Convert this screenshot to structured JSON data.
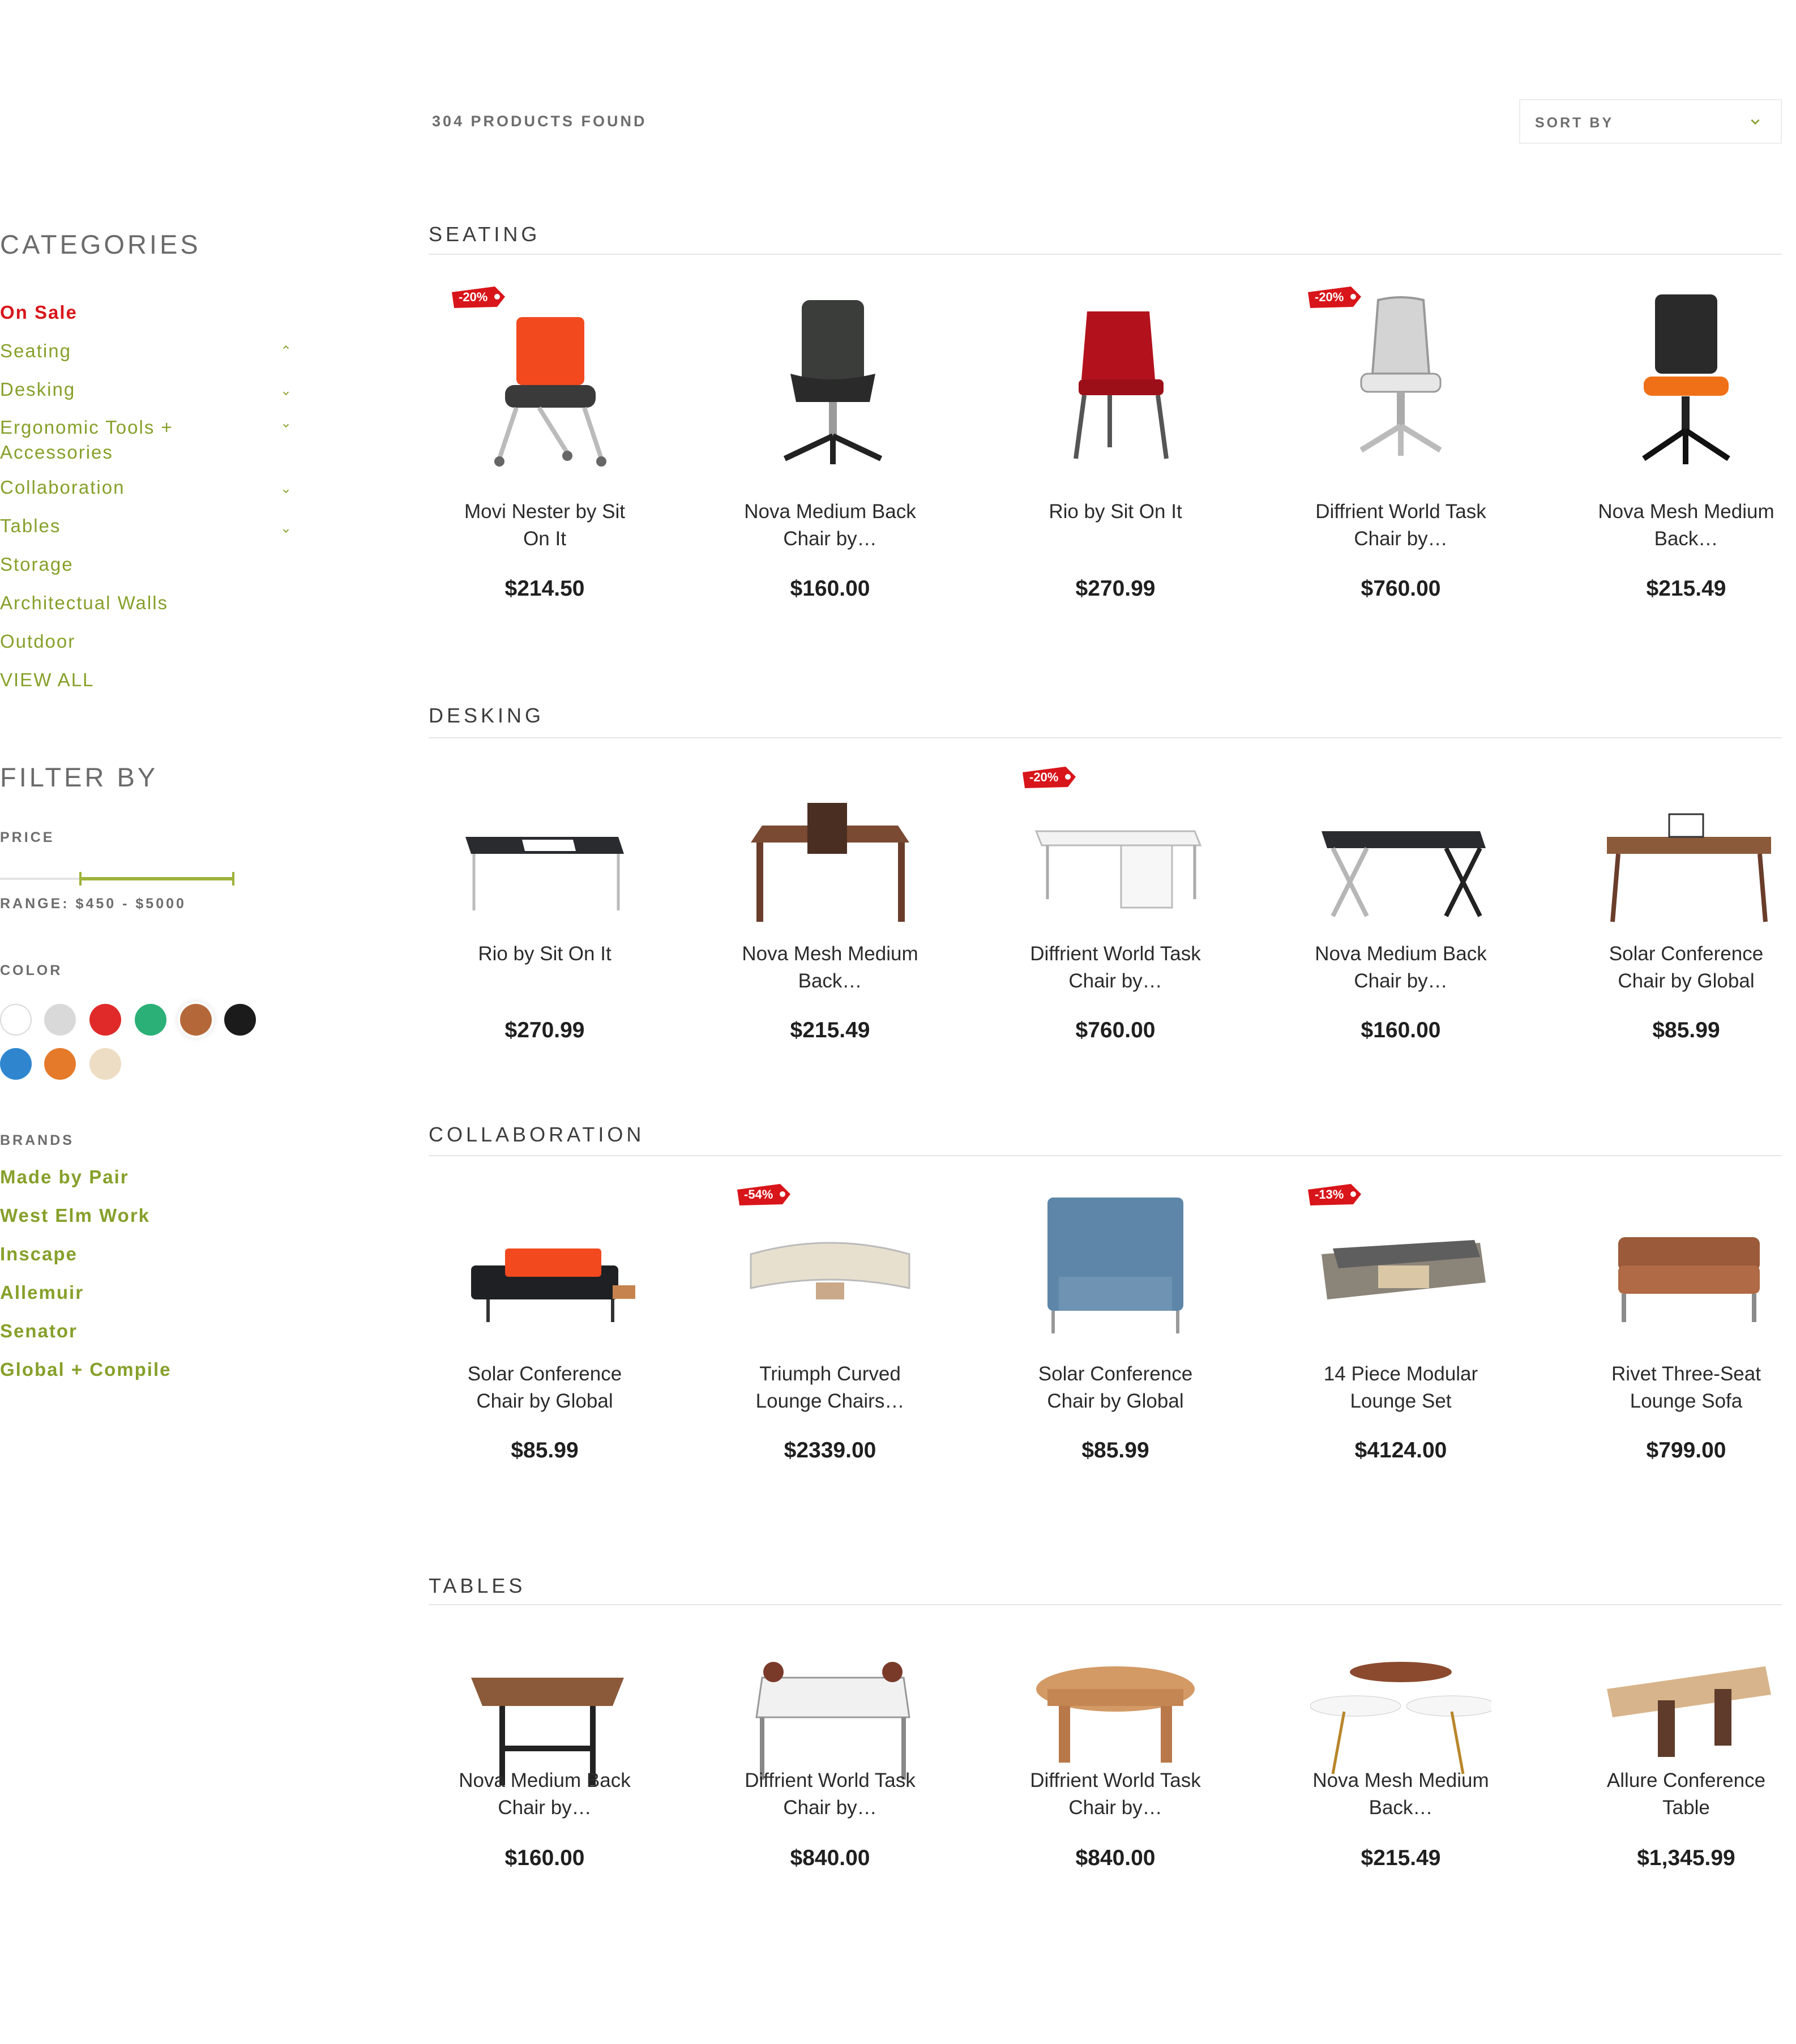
{
  "header": {
    "count": "304 PRODUCTS FOUND",
    "sort_label": "SORT BY"
  },
  "sidebar": {
    "categories_title": "CATEGORIES",
    "categories": [
      {
        "label": "On Sale"
      },
      {
        "label": "Seating"
      },
      {
        "label": "Desking"
      },
      {
        "label": "Ergonomic Tools + Accessories"
      },
      {
        "label": "Collaboration"
      },
      {
        "label": "Tables"
      },
      {
        "label": "Storage"
      },
      {
        "label": "Architectual Walls"
      },
      {
        "label": "Outdoor"
      },
      {
        "label": "VIEW ALL"
      }
    ],
    "filter_title": "FILTER BY",
    "price_label": "PRICE",
    "range_label": "RANGE: $450 - $5000",
    "color_label": "COLOR",
    "colors": [
      "#ffffff",
      "#d9d9d9",
      "#e02a2a",
      "#2bb077",
      "#b4683a",
      "#1b1b1b",
      "#2f86cf",
      "#e57a2a",
      "#eeddc5"
    ],
    "brands_label": "BRANDS",
    "brands": [
      "Made by Pair",
      "West Elm Work",
      "Inscape",
      "Allemuir",
      "Senator",
      "Global + Compile"
    ]
  },
  "sections": [
    {
      "title": "SEATING",
      "products": [
        {
          "name": "Movi Nester by Sit On It",
          "price": "$214.50",
          "badge": "-20%",
          "icon": "orange-nesting-chair-image"
        },
        {
          "name": "Nova Medium Back Chair by…",
          "price": "$160.00",
          "badge": "",
          "icon": "black-office-chair-image"
        },
        {
          "name": "Rio by Sit On It",
          "price": "$270.99",
          "badge": "",
          "icon": "red-chair-image"
        },
        {
          "name": "Diffrient World Task Chair by…",
          "price": "$760.00",
          "badge": "-20%",
          "icon": "mesh-task-chair-image"
        },
        {
          "name": "Nova Mesh Medium Back…",
          "price": "$215.49",
          "badge": "",
          "icon": "mesh-office-chair-image"
        }
      ]
    },
    {
      "title": "DESKING",
      "products": [
        {
          "name": "Rio by Sit On It",
          "price": "$270.99",
          "badge": "",
          "icon": "black-desk-image"
        },
        {
          "name": "Nova Mesh Medium Back…",
          "price": "$215.49",
          "badge": "",
          "icon": "wood-desk-image"
        },
        {
          "name": "Diffrient World Task Chair by…",
          "price": "$760.00",
          "badge": "-20%",
          "icon": "white-desk-image"
        },
        {
          "name": "Nova Medium Back Chair by…",
          "price": "$160.00",
          "badge": "",
          "icon": "cross-leg-desk-image"
        },
        {
          "name": "Solar Conference Chair by Global",
          "price": "$85.99",
          "badge": "",
          "icon": "walnut-desk-image"
        }
      ]
    },
    {
      "title": "COLLABORATION",
      "products": [
        {
          "name": "Solar Conference Chair by Global",
          "price": "$85.99",
          "badge": "",
          "icon": "lounge-bench-image"
        },
        {
          "name": "Triumph Curved Lounge Chairs…",
          "price": "$2339.00",
          "badge": "-54%",
          "icon": "curved-sofa-image"
        },
        {
          "name": "Solar Conference Chair by Global",
          "price": "$85.99",
          "badge": "",
          "icon": "highback-sofa-image"
        },
        {
          "name": "14 Piece Modular Lounge Set",
          "price": "$4124.00",
          "badge": "-13%",
          "icon": "modular-lounge-image"
        },
        {
          "name": "Rivet Three-Seat Lounge Sofa",
          "price": "$799.00",
          "badge": "",
          "icon": "leather-sofa-image"
        }
      ]
    },
    {
      "title": "TABLES",
      "products": [
        {
          "name": "Nova Medium Back Chair by…",
          "price": "$160.00",
          "badge": "",
          "icon": "wood-table-image"
        },
        {
          "name": "Diffrient World Task Chair by…",
          "price": "$840.00",
          "badge": "",
          "icon": "bench-desk-image"
        },
        {
          "name": "Diffrient World Task Chair by…",
          "price": "$840.00",
          "badge": "",
          "icon": "round-wood-table-image"
        },
        {
          "name": "Nova Mesh Medium Back…",
          "price": "$215.49",
          "badge": "",
          "icon": "nesting-tables-image"
        },
        {
          "name": "Allure Conference Table",
          "price": "$1,345.99",
          "badge": "",
          "icon": "conference-table-image"
        }
      ]
    }
  ]
}
